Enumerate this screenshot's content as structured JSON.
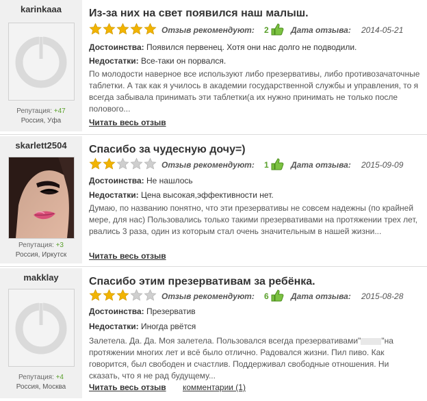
{
  "colors": {
    "accent_green": "#5aa02c",
    "star_gold": "#f2b400",
    "star_empty": "#cfcfcf",
    "sidebar_bg": "#f0f0f0"
  },
  "reviews": [
    {
      "username": "karinkaaa",
      "avatar": "default-avatar-icon",
      "rep_label": "Репутация:",
      "rep_value": "+47",
      "location": "Россия, Уфа",
      "title": "Из-за них на свет появился наш малыш.",
      "rating": 5,
      "recommend_label": "Отзыв рекомендуют:",
      "recommend_count": "2",
      "date_label": "Дата отзыва:",
      "date": "2014-05-21",
      "pros_label": "Достоинства:",
      "pros": "Появился первенец. Хотя они нас долго не подводили.",
      "cons_label": "Недостатки:",
      "cons": "Все-таки он порвался.",
      "body": "По молодости наверное все используют либо презервативы, либо противозачаточные таблетки. А так как я училось в академии государственной службы и управления, то я всегда забывала принимать эти таблетки(а их нужно принимать не только после полового...",
      "read_more": "Читать весь отзыв"
    },
    {
      "username": "skarlett2504",
      "avatar": "woman-portrait-avatar",
      "rep_label": "Репутация:",
      "rep_value": "+3",
      "location": "Россия, Иркутск",
      "title": "Спасибо за чудесную дочу=)",
      "rating": 2,
      "recommend_label": "Отзыв рекомендуют:",
      "recommend_count": "1",
      "date_label": "Дата отзыва:",
      "date": "2015-09-09",
      "pros_label": "Достоинства:",
      "pros": "Не нашлось",
      "cons_label": "Недостатки:",
      "cons": "Цена высокая,эффективности нет.",
      "body": "Думаю, по названию понятно, что эти презервативы не совсем надежны (по крайней мере, для нас) Пользовались только такими презервативами на протяжении трех лет, рвались 3 раза, один из которым стал очень значительным в нашей жизни...",
      "read_more": "Читать весь отзыв"
    },
    {
      "username": "makklay",
      "avatar": "default-avatar-icon",
      "rep_label": "Репутация:",
      "rep_value": "+4",
      "location": "Россия, Москва",
      "title": "Спасибо этим презервативам за ребёнка.",
      "rating": 3,
      "recommend_label": "Отзыв рекомендуют:",
      "recommend_count": "6",
      "date_label": "Дата отзыва:",
      "date": "2015-08-28",
      "pros_label": "Достоинства:",
      "pros": "Презерватив",
      "cons_label": "Недостатки:",
      "cons": "Иногда рвётся",
      "body_a": "Залетела. Да. Да. Моя залетела. Пользовался всегда презервативами\"",
      "body_b": "\"на протяжении многих лет и всё было отлично. Радовался жизни. Пил пиво. Как говорится, был свободен и счастлив. Поддерживал свободные отношения. Ни сказать, что я не рад будущему...",
      "read_more": "Читать весь отзыв",
      "comments": "комментарии (1)"
    }
  ]
}
